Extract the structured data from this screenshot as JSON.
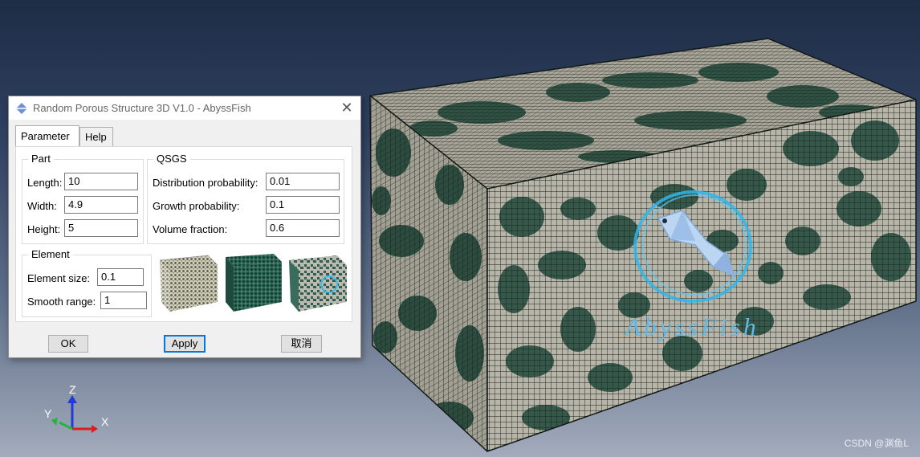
{
  "dialog": {
    "title": "Random Porous Structure 3D V1.0 - AbyssFish",
    "tabs": [
      {
        "label": "Parameter",
        "active": true
      },
      {
        "label": "Help",
        "active": false
      }
    ],
    "part": {
      "title": "Part",
      "length_label": "Length:",
      "length": "10",
      "width_label": "Width:",
      "width": "4.9",
      "height_label": "Height:",
      "height": "5"
    },
    "qsgs": {
      "title": "QSGS",
      "distribution_label": "Distribution probability:",
      "distribution": "0.01",
      "growth_label": "Growth probability:",
      "growth": "0.1",
      "volume_label": "Volume fraction:",
      "volume": "0.6"
    },
    "element": {
      "title": "Element",
      "size_label": "Element size:",
      "size": "0.1",
      "smooth_label": "Smooth range:",
      "smooth": "1"
    },
    "buttons": {
      "ok": "OK",
      "apply": "Apply",
      "cancel": "取消"
    }
  },
  "viewport": {
    "axis": {
      "x": "X",
      "y": "Y",
      "z": "Z"
    },
    "logo_text": "AbyssFish",
    "watermark": "CSDN @渊鱼L"
  },
  "colors": {
    "solid_phase": "#35584a",
    "pore_phase": "#b7b4a8",
    "mesh_lines": "#1c2520",
    "accent": "#0078d7"
  }
}
